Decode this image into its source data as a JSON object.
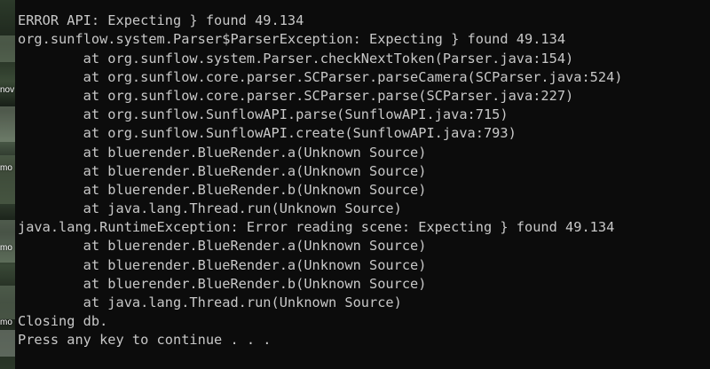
{
  "desktop": {
    "labels": [
      "nov",
      "mo",
      "mo",
      "mo"
    ]
  },
  "console": {
    "lines": [
      "ERROR API: Expecting } found 49.134",
      "org.sunflow.system.Parser$ParserException: Expecting } found 49.134",
      "        at org.sunflow.system.Parser.checkNextToken(Parser.java:154)",
      "        at org.sunflow.core.parser.SCParser.parseCamera(SCParser.java:524)",
      "        at org.sunflow.core.parser.SCParser.parse(SCParser.java:227)",
      "        at org.sunflow.SunflowAPI.parse(SunflowAPI.java:715)",
      "        at org.sunflow.SunflowAPI.create(SunflowAPI.java:793)",
      "        at bluerender.BlueRender.a(Unknown Source)",
      "        at bluerender.BlueRender.a(Unknown Source)",
      "        at bluerender.BlueRender.b(Unknown Source)",
      "        at java.lang.Thread.run(Unknown Source)",
      "java.lang.RuntimeException: Error reading scene: Expecting } found 49.134",
      "        at bluerender.BlueRender.a(Unknown Source)",
      "        at bluerender.BlueRender.a(Unknown Source)",
      "        at bluerender.BlueRender.b(Unknown Source)",
      "        at java.lang.Thread.run(Unknown Source)",
      "Closing db.",
      "Press any key to continue . . ."
    ]
  },
  "colors": {
    "background": "#0c0c0c",
    "text": "#c8c8c8"
  }
}
